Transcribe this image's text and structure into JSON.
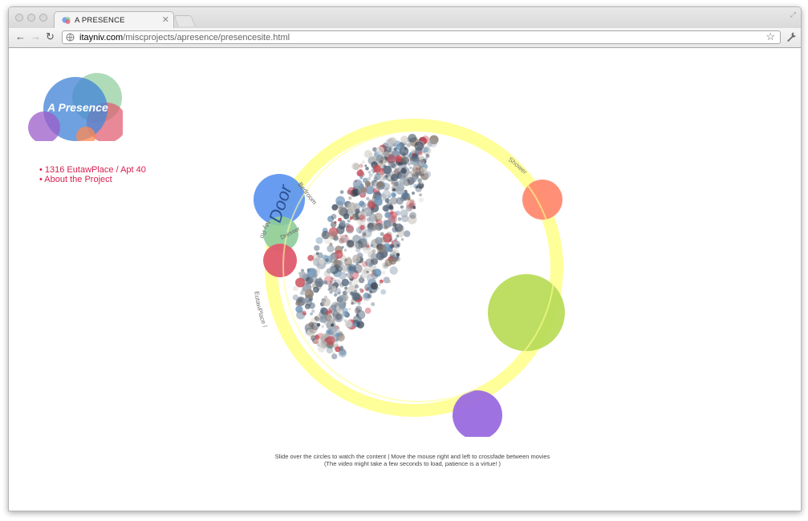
{
  "browser": {
    "tab_title": "A PRESENCE",
    "url_host": "itayniv.com",
    "url_path": "/miscprojects/apresence/presencesite.html"
  },
  "logo": {
    "text": "A Presence"
  },
  "nav": {
    "items": [
      {
        "label": "• 1316 EutawPlace / Apt 40"
      },
      {
        "label": "• About the Project"
      }
    ]
  },
  "viz": {
    "labels": {
      "door": "Door",
      "bedroom": "Bedroom",
      "my_room": "My Ro",
      "dresser": "Dresser",
      "eutaw": "EutawPlace /",
      "shower": "Shower"
    },
    "colors": {
      "ring": "#ffff99",
      "blue": "#5a94ef",
      "red": "#e05a6e",
      "green": "#8dcc9a",
      "salmon": "#ff8a70",
      "lime": "#b9dc5a",
      "purple": "#9a6ae0"
    }
  },
  "instructions": {
    "line1": "Slide over the circles to watch the content | Move the mouse right and left to crossfade between movies",
    "line2": "(The video might take a few seconds to load, patience is a virtue! )"
  }
}
